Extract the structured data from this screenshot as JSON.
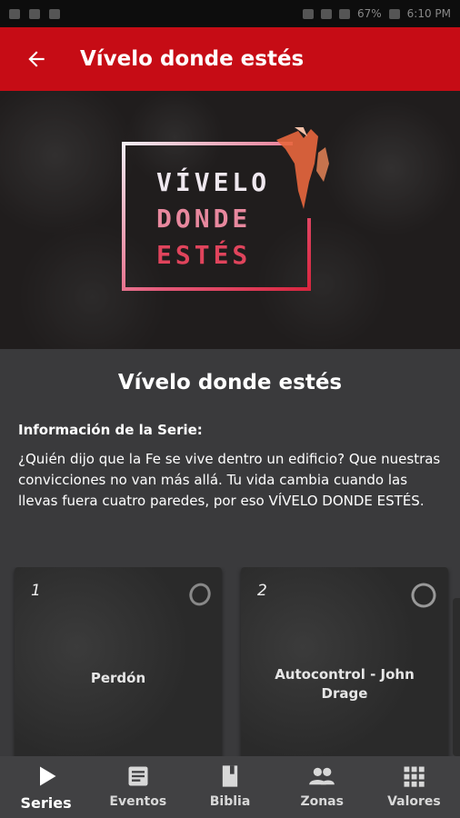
{
  "status_bar": {
    "battery": "67%",
    "time": "6:10 PM"
  },
  "app_bar": {
    "title": "Vívelo donde estés",
    "back_icon": "arrow-back-icon",
    "color": "#c60c15"
  },
  "hero": {
    "logo_lines": [
      "VÍVELO",
      "DONDE",
      "ESTÉS"
    ]
  },
  "series": {
    "title": "Vívelo donde estés",
    "info_label": "Información de la Serie:",
    "description": "¿Quién dijo que la Fe se vive dentro un edificio? Que nuestras convicciones no van más allá. Tu vida cambia cuando las llevas fuera cuatro paredes, por eso VÍVELO DONDE ESTÉS."
  },
  "episodes": [
    {
      "number": "1",
      "title": "Perdón"
    },
    {
      "number": "2",
      "title": "Autocontrol - John Drage"
    }
  ],
  "bottom_nav": [
    {
      "label": "Series",
      "icon": "play-icon",
      "active": true
    },
    {
      "label": "Eventos",
      "icon": "article-icon",
      "active": false
    },
    {
      "label": "Biblia",
      "icon": "book-icon",
      "active": false
    },
    {
      "label": "Zonas",
      "icon": "people-icon",
      "active": false
    },
    {
      "label": "Valores",
      "icon": "grid-icon",
      "active": false
    }
  ]
}
